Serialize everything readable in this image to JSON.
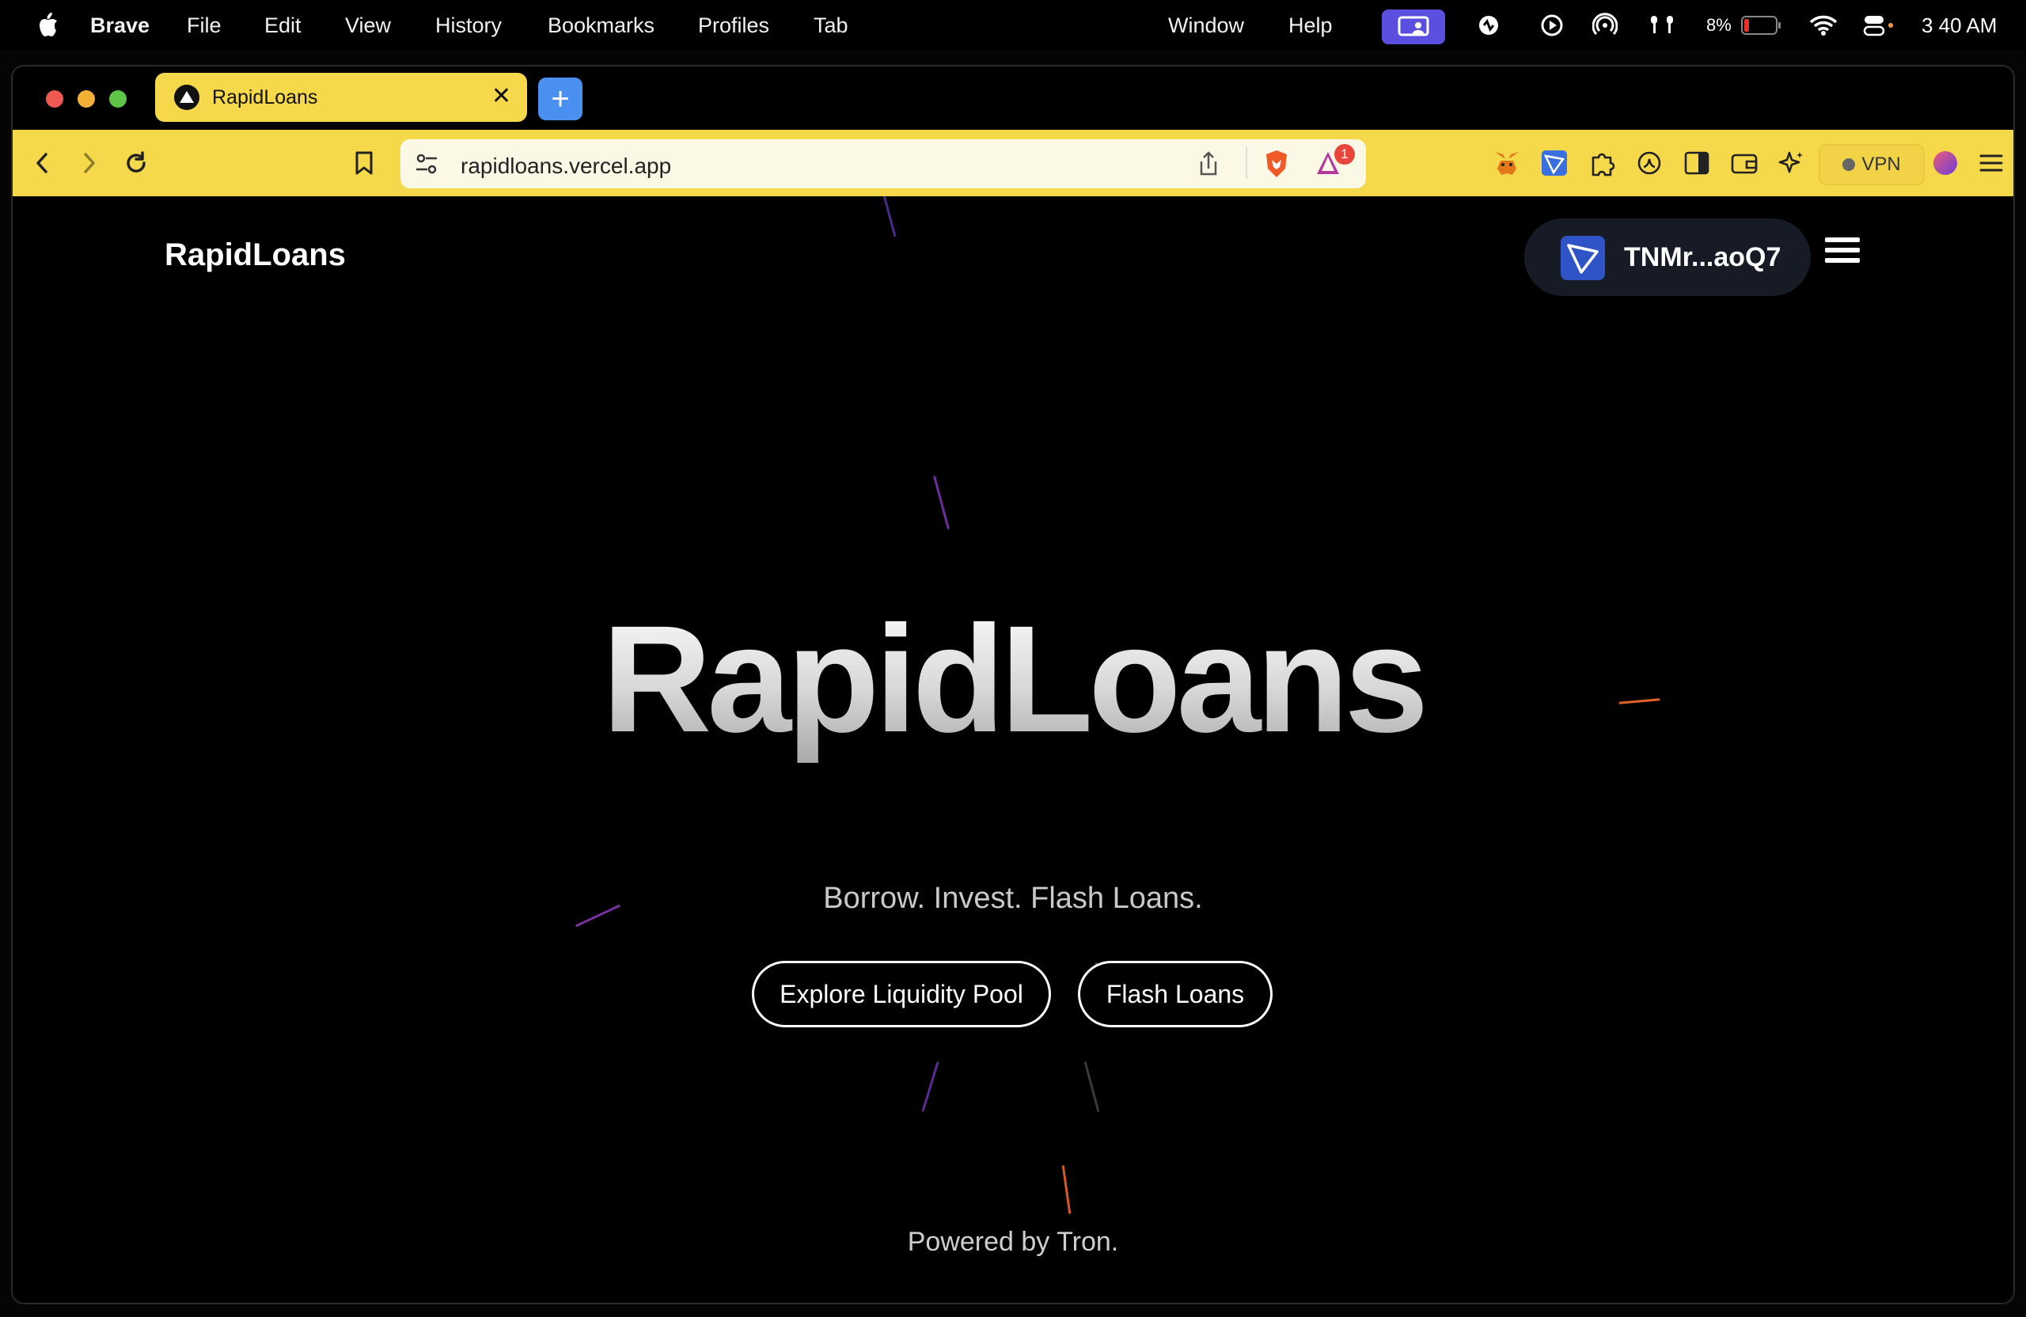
{
  "menubar": {
    "app_name": "Brave",
    "items": [
      "File",
      "Edit",
      "View",
      "History",
      "Bookmarks",
      "Profiles",
      "Tab",
      "Window",
      "Help"
    ],
    "battery_percent": "8%",
    "time": "3 40 AM"
  },
  "browser": {
    "tab": {
      "title": "RapidLoans",
      "close": "✕"
    },
    "new_tab": "+",
    "url": "rapidloans.vercel.app",
    "notification_count": "1",
    "vpn_label": "VPN"
  },
  "page": {
    "brand": "RapidLoans",
    "wallet_address": "TNMr...aoQ7",
    "hero_title": "RapidLoans",
    "tagline": "Borrow. Invest. Flash Loans.",
    "buttons": {
      "liquidity": "Explore Liquidity Pool",
      "flash": "Flash Loans"
    },
    "footer": "Powered by Tron."
  },
  "colors": {
    "toolbar": "#f6d94a",
    "new_tab": "#4a90f0",
    "wallet_bg": "#161b26",
    "battery_low": "#e5322b"
  },
  "icons": [
    "apple-icon",
    "screen-share-icon",
    "activity-icon",
    "play-icon",
    "airdrop-icon",
    "airpods-icon",
    "battery-icon",
    "wifi-icon",
    "control-center-icon",
    "back-icon",
    "forward-icon",
    "reload-icon",
    "bookmark-icon",
    "site-settings-icon",
    "share-icon",
    "brave-shields-icon",
    "brave-rewards-icon",
    "metamask-icon",
    "tronlink-icon",
    "extensions-icon",
    "leo-icon",
    "sidebar-icon",
    "wallet-icon",
    "ai-icon",
    "profile-icon",
    "menu-icon"
  ]
}
